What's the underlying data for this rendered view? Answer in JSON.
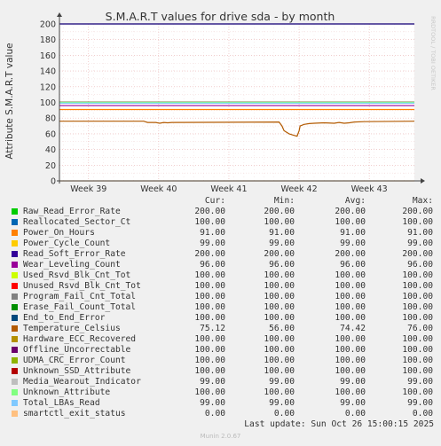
{
  "chart_data": {
    "type": "line",
    "title": "S.M.A.R.T values for drive sda - by month",
    "ylabel": "Attribute S.M.A.R.T value",
    "ylim": [
      0,
      200
    ],
    "yticks": [
      "0",
      "20",
      "40",
      "60",
      "80",
      "100",
      "120",
      "140",
      "160",
      "180",
      "200"
    ],
    "xticks": [
      {
        "label": "Week 39",
        "x": 0.5
      },
      {
        "label": "Week 40",
        "x": 7.5
      },
      {
        "label": "Week 41",
        "x": 14.5
      },
      {
        "label": "Week 42",
        "x": 21.5
      },
      {
        "label": "Week 43",
        "x": 28.5
      }
    ],
    "xlim": [
      -2.4,
      33.0
    ],
    "grid": true,
    "watermark": "RRDTOOL / TOBI OETIKER",
    "temperature_series": [
      [
        -2.4,
        76
      ],
      [
        6.0,
        76
      ],
      [
        6.4,
        74.5
      ],
      [
        7.2,
        74.5
      ],
      [
        7.6,
        73.5
      ],
      [
        8.0,
        74.5
      ],
      [
        8.4,
        74
      ],
      [
        8.8,
        74.5
      ],
      [
        19.5,
        75
      ],
      [
        19.8,
        70
      ],
      [
        20.0,
        64
      ],
      [
        20.5,
        60
      ],
      [
        21.0,
        58
      ],
      [
        21.3,
        57
      ],
      [
        21.5,
        64
      ],
      [
        21.6,
        70
      ],
      [
        22.0,
        72
      ],
      [
        22.5,
        73
      ],
      [
        23.0,
        73.5
      ],
      [
        24.0,
        74
      ],
      [
        25.0,
        73.5
      ],
      [
        25.5,
        74.5
      ],
      [
        26.0,
        73.5
      ],
      [
        26.5,
        74
      ],
      [
        27.0,
        75
      ],
      [
        28.0,
        75.5
      ],
      [
        33.0,
        76
      ]
    ]
  },
  "legend": {
    "headers": {
      "cur": "Cur:",
      "min": "Min:",
      "avg": "Avg:",
      "max": "Max:"
    },
    "rows": [
      {
        "name": "Raw_Read_Error_Rate",
        "color": "#00cc00",
        "value": 200,
        "cur": "200.00",
        "min": "200.00",
        "avg": "200.00",
        "max": "200.00"
      },
      {
        "name": "Reallocated_Sector_Ct",
        "color": "#0066b3",
        "value": 100,
        "cur": "100.00",
        "min": "100.00",
        "avg": "100.00",
        "max": "100.00"
      },
      {
        "name": "Power_On_Hours",
        "color": "#ff8000",
        "value": 91,
        "cur": "91.00",
        "min": "91.00",
        "avg": "91.00",
        "max": "91.00"
      },
      {
        "name": "Power_Cycle_Count",
        "color": "#ffcc00",
        "value": 99,
        "cur": "99.00",
        "min": "99.00",
        "avg": "99.00",
        "max": "99.00"
      },
      {
        "name": "Read_Soft_Error_Rate",
        "color": "#330099",
        "value": 200,
        "cur": "200.00",
        "min": "200.00",
        "avg": "200.00",
        "max": "200.00"
      },
      {
        "name": "Wear_Leveling_Count",
        "color": "#990099",
        "value": 96,
        "cur": "96.00",
        "min": "96.00",
        "avg": "96.00",
        "max": "96.00"
      },
      {
        "name": "Used_Rsvd_Blk_Cnt_Tot",
        "color": "#ccff00",
        "value": 100,
        "cur": "100.00",
        "min": "100.00",
        "avg": "100.00",
        "max": "100.00"
      },
      {
        "name": "Unused_Rsvd_Blk_Cnt_Tot",
        "color": "#ff0000",
        "value": 100,
        "cur": "100.00",
        "min": "100.00",
        "avg": "100.00",
        "max": "100.00"
      },
      {
        "name": "Program_Fail_Cnt_Total",
        "color": "#808080",
        "value": 100,
        "cur": "100.00",
        "min": "100.00",
        "avg": "100.00",
        "max": "100.00"
      },
      {
        "name": "Erase_Fail_Count_Total",
        "color": "#008f00",
        "value": 100,
        "cur": "100.00",
        "min": "100.00",
        "avg": "100.00",
        "max": "100.00"
      },
      {
        "name": "End_to_End_Error",
        "color": "#00487d",
        "value": 100,
        "cur": "100.00",
        "min": "100.00",
        "avg": "100.00",
        "max": "100.00"
      },
      {
        "name": "Temperature_Celsius",
        "color": "#b35a00",
        "value": null,
        "cur": "75.12",
        "min": "56.00",
        "avg": "74.42",
        "max": "76.00"
      },
      {
        "name": "Hardware_ECC_Recovered",
        "color": "#b38f00",
        "value": 100,
        "cur": "100.00",
        "min": "100.00",
        "avg": "100.00",
        "max": "100.00"
      },
      {
        "name": "Offline_Uncorrectable",
        "color": "#6b006b",
        "value": 100,
        "cur": "100.00",
        "min": "100.00",
        "avg": "100.00",
        "max": "100.00"
      },
      {
        "name": "UDMA_CRC_Error_Count",
        "color": "#8fb300",
        "value": 100,
        "cur": "100.00",
        "min": "100.00",
        "avg": "100.00",
        "max": "100.00"
      },
      {
        "name": "Unknown_SSD_Attribute",
        "color": "#b30000",
        "value": 100,
        "cur": "100.00",
        "min": "100.00",
        "avg": "100.00",
        "max": "100.00"
      },
      {
        "name": "Media_Wearout_Indicator",
        "color": "#bebebe",
        "value": 99,
        "cur": "99.00",
        "min": "99.00",
        "avg": "99.00",
        "max": "99.00"
      },
      {
        "name": "Unknown_Attribute",
        "color": "#80ff80",
        "value": 100,
        "cur": "100.00",
        "min": "100.00",
        "avg": "100.00",
        "max": "100.00"
      },
      {
        "name": "Total_LBAs_Read",
        "color": "#80c9ff",
        "value": 99,
        "cur": "99.00",
        "min": "99.00",
        "avg": "99.00",
        "max": "99.00"
      },
      {
        "name": "smartctl_exit_status",
        "color": "#ffc080",
        "value": 0,
        "cur": "0.00",
        "min": "0.00",
        "avg": "0.00",
        "max": "0.00"
      }
    ]
  },
  "footer": {
    "last_update": "Last update: Sun Oct 26 15:00:15 2025",
    "version": "Munin 2.0.67"
  }
}
